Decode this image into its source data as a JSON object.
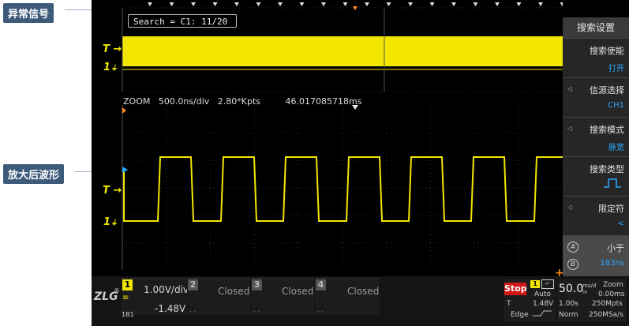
{
  "callouts": {
    "top": "异常信号",
    "middle": "放大后波形"
  },
  "search_text": "Search = C1: 11/20",
  "trigger": {
    "t_label": "T →",
    "one_label": "1",
    "ch_mark": "⏚"
  },
  "zoom": {
    "label": "ZOOM",
    "timebase": "500.0ns/div",
    "points": "2.80*Kpts",
    "time": "46.017085718ms"
  },
  "menu": {
    "title": "搜索设置",
    "items": [
      {
        "label": "搜索使能",
        "value": "打开"
      },
      {
        "label": "信源选择",
        "value": "CH1"
      },
      {
        "label": "搜索模式",
        "value": "脉宽"
      },
      {
        "label": "搜索类型",
        "value": ""
      },
      {
        "label": "限定符",
        "value": "<"
      }
    ],
    "qualifier": {
      "a": "A",
      "b": "B",
      "label": "小于",
      "value": "183ns"
    }
  },
  "bottom": {
    "ch1": {
      "num": "1",
      "volts": "1.00V/div",
      "offset": "-1.48V",
      "sub": "1B1"
    },
    "ch2": {
      "num": "2",
      "state": "Closed"
    },
    "ch3": {
      "num": "3",
      "state": "Closed"
    },
    "ch4": {
      "num": "4",
      "state": "Closed"
    },
    "run": {
      "stop": "Stop",
      "mode": "Auto",
      "trig_ch": "1",
      "t": "T",
      "level": "1.48V",
      "type": "Edge"
    },
    "timebase": {
      "value": "50.0",
      "unit": "ms/div",
      "zoom": "Zoom",
      "zoom_val": "0.00ms",
      "pos": "1.00s",
      "pts": "250Mpts",
      "norm": "Norm",
      "rate": "250MSa/s"
    }
  },
  "colors": {
    "trace": "#f2e600",
    "accent": "#29a9ff",
    "stop": "#d01818"
  }
}
